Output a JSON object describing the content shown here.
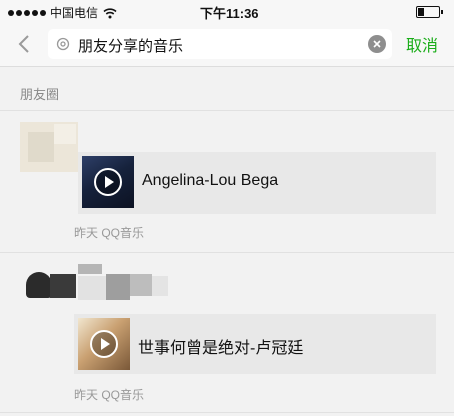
{
  "status_bar": {
    "carrier": "中国电信",
    "time": "下午11:36"
  },
  "search": {
    "query": "朋友分享的音乐"
  },
  "cancel_label": "取消",
  "section": {
    "title": "朋友圈"
  },
  "results": [
    {
      "song": "Angelina-Lou Bega",
      "meta": "昨天 QQ音乐"
    },
    {
      "song": "世事何曾是绝对-卢冠廷",
      "meta": "昨天 QQ音乐"
    }
  ],
  "colors": {
    "accent": "#1aad19",
    "card": "#e8e8e8",
    "background": "#f2f2f2"
  }
}
